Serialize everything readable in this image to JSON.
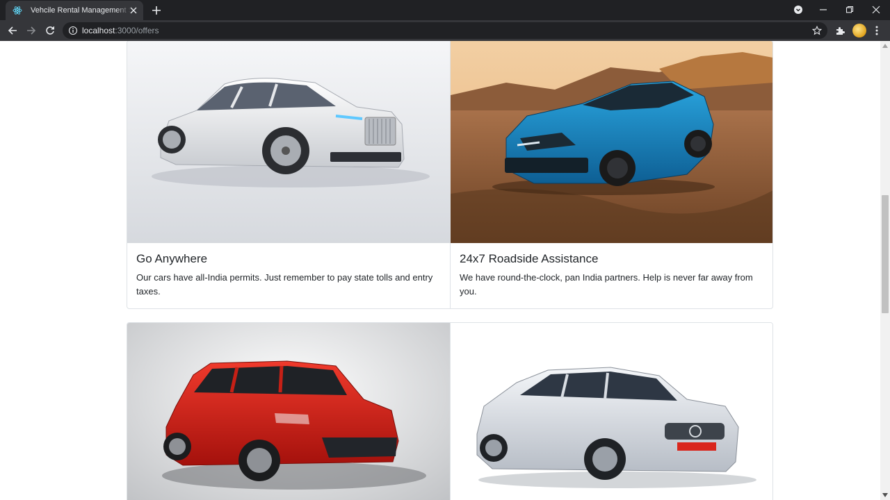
{
  "browser": {
    "tab_title": "Vehcile Rental Management System",
    "url_host": "localhost",
    "url_rest": ":3000/offers"
  },
  "offers": [
    {
      "title": "Go Anywhere",
      "text": "Our cars have all-India permits. Just remember to pay state tolls and entry taxes.",
      "image": "white-luxury-sedan"
    },
    {
      "title": "24x7 Roadside Assistance",
      "text": "We have round-the-clock, pan India partners. Help is never far away from you.",
      "image": "blue-sports-car-desert"
    },
    {
      "title": "",
      "text": "",
      "image": "red-hatchback"
    },
    {
      "title": "",
      "text": "",
      "image": "silver-sedan"
    }
  ],
  "colors": {
    "accent_blue": "#1e7fb8",
    "red_car": "#d8231c"
  }
}
